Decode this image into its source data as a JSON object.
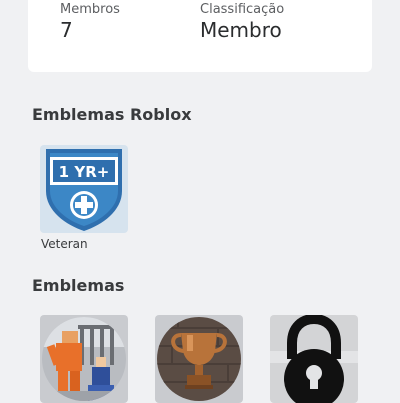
{
  "stats": {
    "members_label": "Membros",
    "members_value": "7",
    "rank_label": "Classificação",
    "rank_value": "Membro"
  },
  "roblox_badges": {
    "title": "Emblemas Roblox",
    "items": [
      {
        "name": "Veteran",
        "icon_text": "1 YR+",
        "icon": "veteran-shield-icon"
      }
    ]
  },
  "badges": {
    "title": "Emblemas",
    "items": [
      {
        "icon": "prison-escape-badge-icon"
      },
      {
        "icon": "trophy-badge-icon"
      },
      {
        "icon": "padlock-badge-icon"
      }
    ]
  },
  "colors": {
    "background": "#f0f1f3",
    "card": "#ffffff",
    "veteran_blue": "#3c87c6",
    "trophy_bronze": "#b8733a"
  }
}
